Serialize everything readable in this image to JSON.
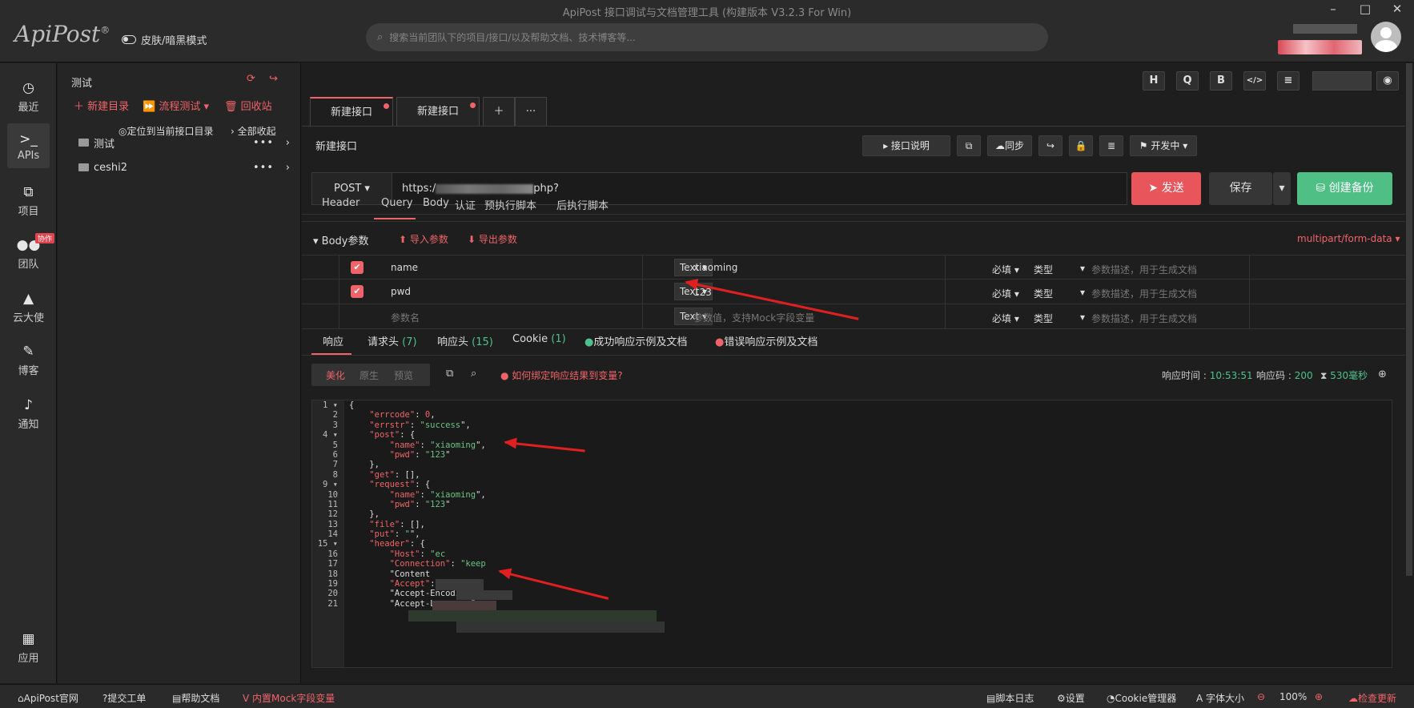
{
  "app": {
    "title": "ApiPost 接口调试与文档管理工具 (构建版本 V3.2.3 For Win)",
    "logo": "ApiPost",
    "theme_toggle": "皮肤/暗黑模式",
    "search_placeholder": "搜索当前团队下的项目/接口/以及帮助文档、技术博客等..."
  },
  "nav": [
    {
      "label": "最近",
      "icon": "clock-icon"
    },
    {
      "label": "APIs",
      "icon": "terminal-icon"
    },
    {
      "label": "项目",
      "icon": "projects-icon"
    },
    {
      "label": "团队",
      "icon": "team-icon"
    },
    {
      "label": "云大使",
      "icon": "graduation-cap-icon"
    },
    {
      "label": "博客",
      "icon": "edit-icon"
    },
    {
      "label": "通知",
      "icon": "bell-icon"
    },
    {
      "label": "应用",
      "icon": "grid-icon"
    }
  ],
  "nav_badge": "协作",
  "tree": {
    "title": "测试",
    "new_dir": "新建目录",
    "flow_test": "流程测试",
    "recycle": "回收站",
    "locate": "定位到当前接口目录",
    "collapse": "全部收起",
    "folders": [
      "测试",
      "ceshi2"
    ]
  },
  "tabs": [
    "新建接口",
    "新建接口"
  ],
  "format_buttons": [
    "H",
    "Q",
    "B",
    "</>",
    "≡"
  ],
  "api": {
    "name": "新建接口",
    "doc_btn": "接口说明",
    "sync_btn": "同步",
    "status": "开发中",
    "method": "POST",
    "url_prefix": "https:/",
    "url_suffix": "php?",
    "send": "发送",
    "save": "保存",
    "backup": "创建备份"
  },
  "req_tabs": [
    "Header",
    "Query",
    "Body",
    "认证",
    "预执行脚本",
    "后执行脚本"
  ],
  "body": {
    "title": "Body参数",
    "import": "导入参数",
    "export": "导出参数",
    "content_type": "multipart/form-data",
    "rows": [
      {
        "name": "name",
        "type": "Text",
        "value": "xiaoming",
        "required": "必填",
        "dtype": "类型",
        "desc_placeholder": "参数描述，用于生成文档"
      },
      {
        "name": "pwd",
        "type": "Text",
        "value": "123",
        "required": "必填",
        "dtype": "类型",
        "desc_placeholder": "参数描述，用于生成文档"
      }
    ],
    "empty_row": {
      "name_placeholder": "参数名",
      "type": "Text",
      "value_placeholder": "参数值，支持Mock字段变量",
      "required": "必填",
      "dtype": "类型",
      "desc_placeholder": "参数描述，用于生成文档"
    }
  },
  "resp_tabs": [
    {
      "label": "响应",
      "count": ""
    },
    {
      "label": "请求头",
      "count": "(7)"
    },
    {
      "label": "响应头",
      "count": "(15)"
    },
    {
      "label": "Cookie",
      "count": "(1)"
    },
    {
      "label": "成功响应示例及文档",
      "count": ""
    },
    {
      "label": "错误响应示例及文档",
      "count": ""
    }
  ],
  "resp": {
    "view_modes": [
      "美化",
      "原生",
      "预览"
    ],
    "help": "如何绑定响应结果到变量?",
    "time_label": "响应时间 : ",
    "time": "10:53:51",
    "code_label": "响应码 : ",
    "code": "200",
    "duration": "530毫秒"
  },
  "code_lines": [
    "{",
    "    \"errcode\": 0,",
    "    \"errstr\": \"success\",",
    "    \"post\": {",
    "        \"name\": \"xiaoming\",",
    "        \"pwd\": \"123\"",
    "    },",
    "    \"get\": [],",
    "    \"request\": {",
    "        \"name\": \"xiaoming\",",
    "        \"pwd\": \"123\"",
    "    },",
    "    \"file\": [],",
    "    \"put\": \"\",",
    "    \"header\": {",
    "        \"Host\": \"ec",
    "        \"Connection\": \"keep",
    "        \"Content",
    "        \"Accept\":",
    "        \"Accept-Encoding",
    "        \"Accept-Language\""
  ],
  "status": {
    "site": "ApiPost官网",
    "ticket": "提交工单",
    "help": "帮助文档",
    "mock": "内置Mock字段变量",
    "log": "脚本日志",
    "settings": "设置",
    "cookie": "Cookie管理器",
    "font": "字体大小",
    "zoom": "100%",
    "update": "检查更新"
  },
  "colors": {
    "accent": "#f06469",
    "send": "#e8555a",
    "backup": "#4fbf85"
  }
}
